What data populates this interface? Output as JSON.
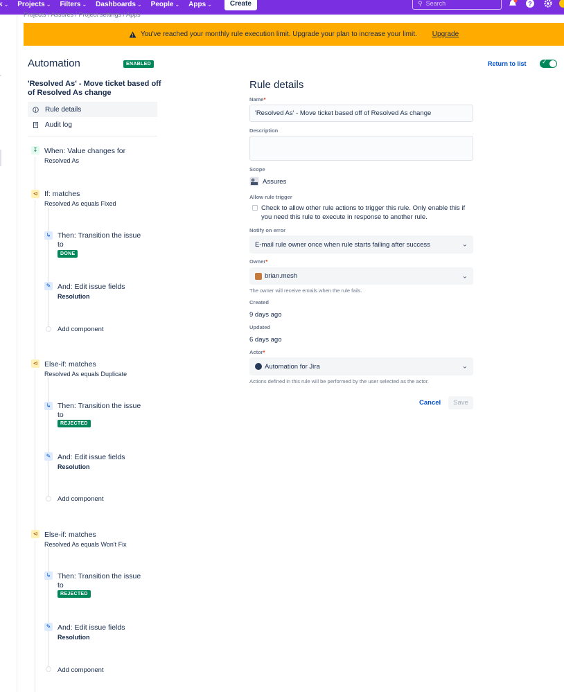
{
  "nav": {
    "items": [
      {
        "label": "k",
        "chevron": true
      },
      {
        "label": "Projects",
        "chevron": true
      },
      {
        "label": "Filters",
        "chevron": true
      },
      {
        "label": "Dashboards",
        "chevron": true
      },
      {
        "label": "People",
        "chevron": true
      },
      {
        "label": "Apps",
        "chevron": true
      }
    ],
    "create_label": "Create",
    "search_placeholder": "Search"
  },
  "breadcrumb": "Projects  /  Assures  /  Project settings  /  Apps",
  "banner": {
    "message": "You've reached your monthly rule execution limit. Upgrade your plan to increase your limit.",
    "link": "Upgrade"
  },
  "header": {
    "title": "Automation",
    "status": "ENABLED",
    "return_link": "Return to list"
  },
  "rule_name": "'Resolved As' - Move ticket based off of Resolved As change",
  "side_menu": [
    {
      "label": "Rule details"
    },
    {
      "label": "Audit log"
    }
  ],
  "components": {
    "trigger": {
      "title": "When: Value changes for",
      "subtitle": "Resolved As"
    },
    "if1": {
      "title": "If: matches",
      "subtitle": "Resolved As equals Fixed"
    },
    "then1": {
      "title_a": "Then: Transition the issue",
      "title_b": "to",
      "status": "DONE"
    },
    "and1": {
      "title": "And: Edit issue fields",
      "subtitle": "Resolution"
    },
    "add1": "Add component",
    "if2": {
      "title": "Else-if: matches",
      "subtitle": "Resolved As equals Duplicate"
    },
    "then2": {
      "title_a": "Then: Transition the issue",
      "title_b": "to",
      "status": "REJECTED"
    },
    "and2": {
      "title": "And: Edit issue fields",
      "subtitle": "Resolution"
    },
    "add2": "Add component",
    "if3": {
      "title": "Else-if: matches",
      "subtitle": "Resolved As equals Won't Fix"
    },
    "then3": {
      "title_a": "Then: Transition the issue",
      "title_b": "to",
      "status": "REJECTED"
    },
    "and3": {
      "title": "And: Edit issue fields",
      "subtitle": "Resolution"
    },
    "add3": "Add component"
  },
  "details": {
    "title": "Rule details",
    "name_label": "Name",
    "name_value": "'Resolved As' - Move ticket based off of Resolved As change",
    "description_label": "Description",
    "description_value": "",
    "scope_label": "Scope",
    "scope_value": "Assures",
    "allow_label": "Allow rule trigger",
    "allow_text": "Check to allow other rule actions to trigger this rule. Only enable this if you need this rule to execute in response to another rule.",
    "notify_label": "Notify on error",
    "notify_value": "E-mail rule owner once when rule starts failing after success",
    "owner_label": "Owner",
    "owner_value": "brian.mesh",
    "owner_help": "The owner will receive emails when the rule fails.",
    "created_label": "Created",
    "created_value": "9 days ago",
    "updated_label": "Updated",
    "updated_value": "6 days ago",
    "actor_label": "Actor",
    "actor_value": "Automation for Jira",
    "actor_help": "Actions defined in this rule will be performed by the user selected as the actor.",
    "cancel_label": "Cancel",
    "save_label": "Save"
  },
  "colors": {
    "nav": "#7a2fe0",
    "banner": "#ffab00",
    "enabled": "#00875a",
    "link": "#0052cc"
  }
}
